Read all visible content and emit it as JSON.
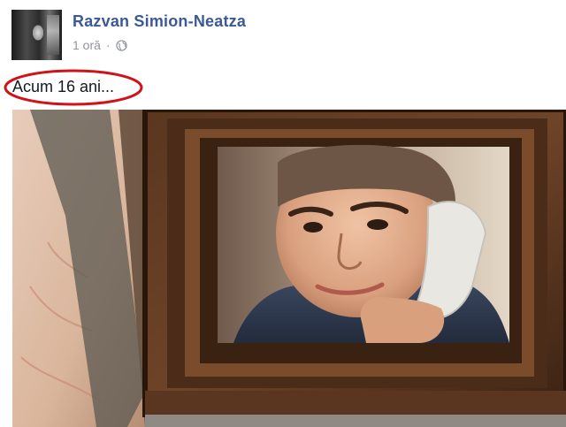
{
  "post": {
    "author_name": "Razvan Simion-Neatza",
    "timestamp": "1 oră",
    "separator": "·",
    "privacy_icon": "globe-icon",
    "status_text": "Acum 16 ani...",
    "highlight_color": "#d0121b"
  },
  "colors": {
    "name": "#3b5998",
    "meta": "#90949c",
    "text": "#141823"
  }
}
